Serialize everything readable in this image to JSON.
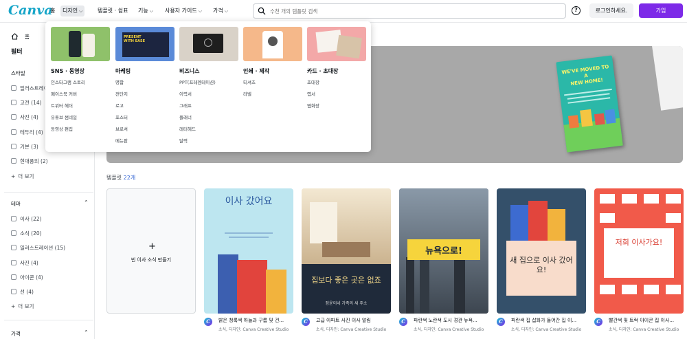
{
  "header": {
    "logo": "Canva",
    "nav": [
      {
        "label": "홈"
      },
      {
        "label": "디자인",
        "chevron": true
      },
      {
        "label": "템플릿 · 쉼표"
      },
      {
        "label": "기능",
        "chevron": true
      },
      {
        "label": "사용자 가이드",
        "chevron": true
      },
      {
        "label": "가격",
        "chevron": true
      }
    ],
    "search_placeholder": "수천 개의 템플릿 검색",
    "help": "?",
    "login": "로그인하세요.",
    "signup": "가입"
  },
  "sidebar": {
    "home": "홈",
    "filter_title": "필터",
    "style_heading": "스타일",
    "style_items": [
      "일러스트레이션",
      "고전 (14)",
      "사진 (4)",
      "테두리 (4)",
      "기본 (3)",
      "현대풍의 (2)"
    ],
    "more1": "더 보기",
    "theme_heading": "테마",
    "theme_items": [
      "이사 (22)",
      "소식 (20)",
      "일러스트레이션 (15)",
      "사진 (4)",
      "아이콘 (4)",
      "선 (4)"
    ],
    "more2": "더 보기",
    "price_heading": "가격"
  },
  "main": {
    "results_label": "템플릿",
    "results_count": "22개",
    "create_blank": "빈 이사 소식 만들기",
    "cards": [
      {
        "title": "밝은 청록색 하늘과 구름 및 건...",
        "byline": "소식, 디자인: Canva Creative Studio",
        "art_text": "이사 갔어요"
      },
      {
        "title": "고급 아파트 사진 이사 알림",
        "byline": "소식, 디자인: Canva Creative Studio",
        "art_text": "집보다 좋은 곳은 없죠",
        "art_sub": "정윤이네 가족의 새 주소"
      },
      {
        "title": "파란색 노란색 도시 경관 뉴욕...",
        "byline": "소식, 디자인: Canva Creative Studio",
        "art_text": "뉴욕으로!"
      },
      {
        "title": "파란색 집 삽화가 들어간 집 이...",
        "byline": "소식, 디자인: Canva Creative Studio",
        "art_text": "새 집으로 이사 갔어요!"
      },
      {
        "title": "빨간색 및 트럭 아이콘 집 이사...",
        "byline": "소식, 디자인: Canva Creative Studio",
        "art_text": "저희 이사가요!"
      }
    ],
    "hero_card": {
      "line1": "WE'VE MOVED TO A",
      "line2": "NEW HOME!"
    }
  },
  "menu": {
    "columns": [
      {
        "heading": "SNS · 동영상",
        "links": [
          "인스타그램 스토리",
          "페이스북 커버",
          "트위터 헤더",
          "유튜브 썸네일",
          "동영상 편집"
        ]
      },
      {
        "heading": "마케팅",
        "links": [
          "명함",
          "전단지",
          "로고",
          "포스터",
          "브로셔",
          "메뉴판"
        ],
        "thumb_text": "PRESENT WITH EASE"
      },
      {
        "heading": "비즈니스",
        "links": [
          "PPT(프레젠테이션)",
          "이력서",
          "그래프",
          "플래너",
          "레터헤드",
          "달력"
        ]
      },
      {
        "heading": "인쇄 · 제작",
        "links": [
          "티셔츠",
          "라벨"
        ]
      },
      {
        "heading": "카드 · 초대장",
        "links": [
          "초대장",
          "엽서",
          "엽화장"
        ]
      }
    ]
  },
  "colors": {
    "accent": "#7d2ae8",
    "logo": "#16a5c8"
  }
}
